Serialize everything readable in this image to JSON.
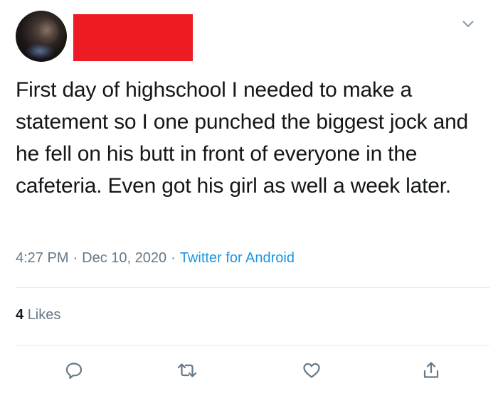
{
  "tweet": {
    "text": "First day of highschool I needed to make a statement so I one punched the biggest jock and he fell on his butt in front of everyone in the cafeteria. Even got his girl as well a week later.",
    "time": "4:27 PM",
    "separator": "·",
    "date": "Dec 10, 2020",
    "client": "Twitter for Android",
    "likes_count": "4",
    "likes_label": "Likes"
  },
  "colors": {
    "text": "#14171a",
    "muted": "#657786",
    "link": "#1b95e0",
    "redaction": "#ed1c24",
    "divider": "#e6ecf0"
  },
  "icons": {
    "caret": "chevron-down-icon",
    "reply": "reply-icon",
    "retweet": "retweet-icon",
    "like": "heart-icon",
    "share": "share-icon"
  }
}
